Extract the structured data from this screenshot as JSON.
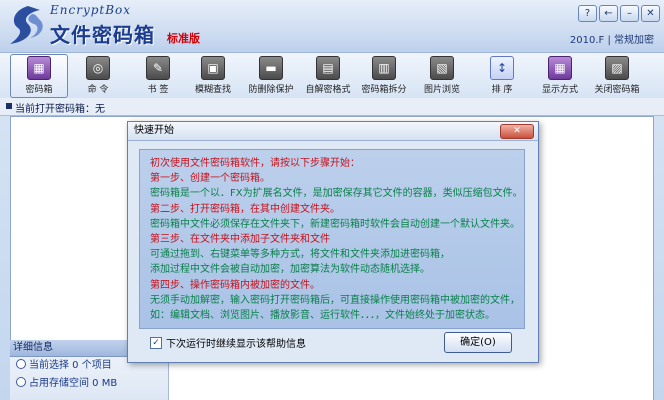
{
  "app": {
    "logo_en": "EncryptBox",
    "logo_cn": "文件密码箱",
    "edition": "标准版",
    "version": "2010.F",
    "mode": "常规加密"
  },
  "window_controls": [
    {
      "name": "help-button",
      "label": "?"
    },
    {
      "name": "back-button",
      "label": "←"
    },
    {
      "name": "minimize-button",
      "label": "–"
    },
    {
      "name": "close-button",
      "label": "✕"
    }
  ],
  "toolbar": [
    {
      "label": "密码箱",
      "icon": "lock-box-icon",
      "glyph": "▦",
      "style": "purple",
      "active": true
    },
    {
      "label": "命 令",
      "icon": "command-icon",
      "glyph": "◎",
      "style": "gray"
    },
    {
      "label": "书 签",
      "icon": "bookmark-icon",
      "glyph": "✎",
      "style": "gray"
    },
    {
      "label": "模糊查找",
      "icon": "search-icon",
      "glyph": "▣",
      "style": "gray"
    },
    {
      "label": "防删除保护",
      "icon": "protect-icon",
      "glyph": "▬",
      "style": "gray"
    },
    {
      "label": "自解密格式",
      "icon": "self-decrypt-icon",
      "glyph": "▤",
      "style": "gray"
    },
    {
      "label": "密码箱拆分",
      "icon": "split-icon",
      "glyph": "▥",
      "style": "gray"
    },
    {
      "label": "图片浏览",
      "icon": "image-view-icon",
      "glyph": "▧",
      "style": "gray"
    },
    {
      "label": "排 序",
      "icon": "sort-icon",
      "glyph": "↕",
      "style": "blue"
    },
    {
      "label": "显示方式",
      "icon": "view-mode-icon",
      "glyph": "▦",
      "style": "purple"
    },
    {
      "label": "关闭密码箱",
      "icon": "close-box-icon",
      "glyph": "▨",
      "style": "gray"
    }
  ],
  "status": {
    "current_box": "当前打开密码箱：无"
  },
  "details": {
    "header": "详细信息",
    "rows": [
      "当前选择 0 个项目",
      "占用存储空间 0 MB"
    ]
  },
  "dialog": {
    "title": "快速开始",
    "close_label": "关闭",
    "lines": [
      {
        "text": "初次使用文件密码箱软件，请按以下步骤开始：",
        "color": "red"
      },
      {
        "text": "第一步、创建一个密码箱。",
        "color": "red"
      },
      {
        "text": "密码箱是一个以．FX为扩展名文件，是加密保存其它文件的容器，类似压缩包文件。",
        "color": "green"
      },
      {
        "text": "第二步、打开密码箱，在其中创建文件夹。",
        "color": "red"
      },
      {
        "text": "密码箱中文件必须保存在文件夹下，新建密码箱时软件会自动创建一个默认文件夹。",
        "color": "green"
      },
      {
        "text": "第三步、在文件夹中添加子文件夹和文件",
        "color": "red"
      },
      {
        "text": "可通过拖到、右键菜单等多种方式，将文件和文件夹添加进密码箱，",
        "color": "green"
      },
      {
        "text": "添加过程中文件会被自动加密，加密算法为软件动态随机选择。",
        "color": "green"
      },
      {
        "text": "第四步、操作密码箱内被加密的文件。",
        "color": "red"
      },
      {
        "text": "无须手动加解密，输入密码打开密码箱后，可直接操作使用密码箱中被加密的文件，",
        "color": "green"
      },
      {
        "text": "如：编辑文档、浏览图片、播放影音、运行软件．．．，文件始终处于加密状态。",
        "color": "green"
      }
    ],
    "checkbox_label": "下次运行时继续显示该帮助信息",
    "checkbox_checked": "✓",
    "ok_label": "确定(O)"
  }
}
